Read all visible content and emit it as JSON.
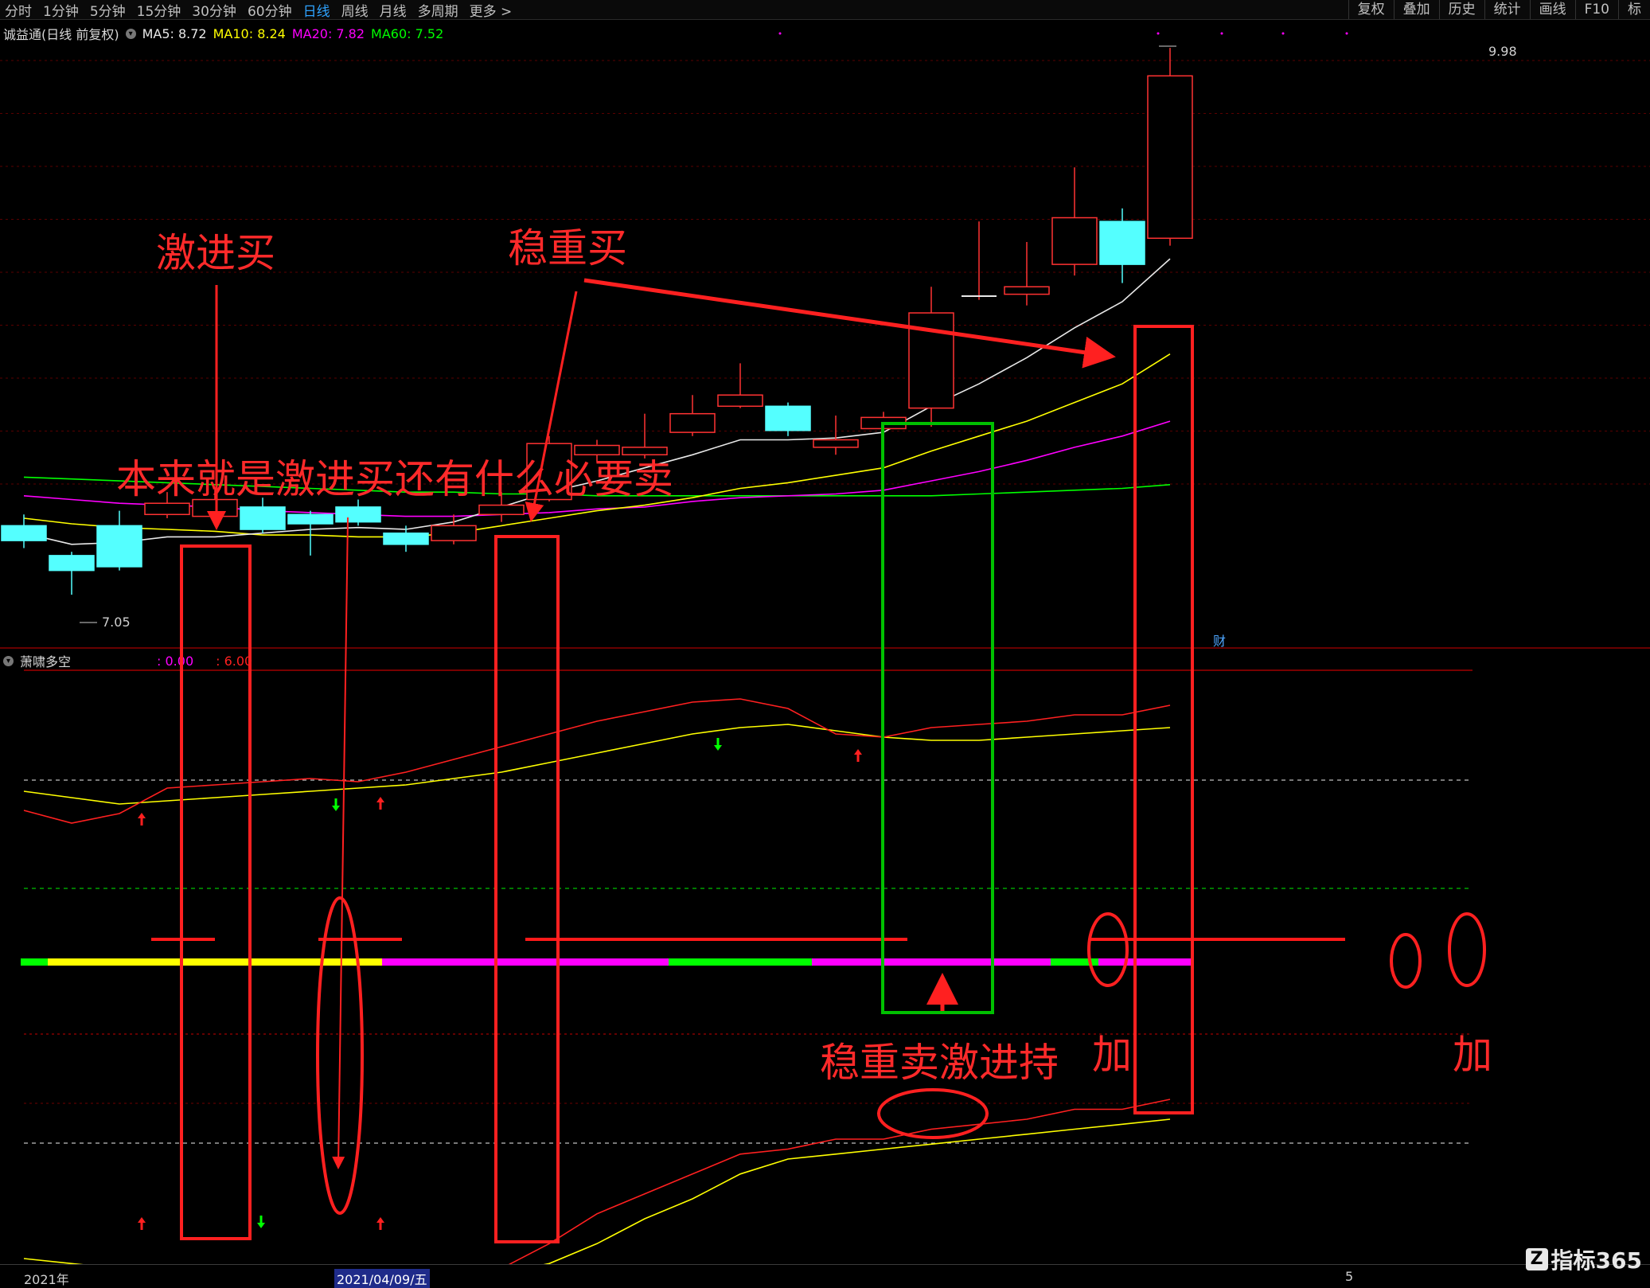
{
  "toolbar": {
    "period_tabs": [
      "分时",
      "1分钟",
      "5分钟",
      "15分钟",
      "30分钟",
      "60分钟",
      "日线",
      "周线",
      "月线",
      "多周期",
      "更多 >"
    ],
    "active_tab": "日线",
    "right_tabs": [
      "复权",
      "叠加",
      "历史",
      "统计",
      "画线",
      "F10",
      "标"
    ]
  },
  "main_legend": {
    "title": "诚益通(日线 前复权)",
    "ma5": "MA5: 8.72",
    "ma10": "MA10: 8.24",
    "ma20": "MA20: 7.82",
    "ma60": "MA60: 7.52",
    "colors": {
      "ma5": "#e8e8e8",
      "ma10": "#ffff00",
      "ma20": "#ff00ff",
      "ma60": "#00ff00"
    }
  },
  "price_labels": {
    "high": "9.98",
    "low": "7.05",
    "cai_badge": "财"
  },
  "indicator_legend": {
    "title": "萧啸多空",
    "v1": ": 0.00",
    "v2": ": 6.00"
  },
  "annotations": {
    "aggressive_buy": "激进买",
    "steady_buy": "稳重买",
    "why_sell": "本来就是激进买还有什么必要卖",
    "steady_sell": "稳重卖激进持",
    "add1": "加",
    "add2": "加"
  },
  "dates": {
    "year": "2021年",
    "selected": "2021/04/09/五",
    "right_marker": "5"
  },
  "logo": {
    "mark": "Z",
    "text": "指标365"
  },
  "chart_data": {
    "type": "candlestick",
    "candles": [
      {
        "o": 7.42,
        "c": 7.34,
        "h": 7.48,
        "l": 7.3
      },
      {
        "o": 7.26,
        "c": 7.18,
        "h": 7.28,
        "l": 7.05
      },
      {
        "o": 7.42,
        "c": 7.2,
        "h": 7.5,
        "l": 7.18
      },
      {
        "o": 7.48,
        "c": 7.54,
        "h": 7.6,
        "l": 7.46
      },
      {
        "o": 7.47,
        "c": 7.56,
        "h": 7.62,
        "l": 7.44
      },
      {
        "o": 7.52,
        "c": 7.4,
        "h": 7.57,
        "l": 7.38
      },
      {
        "o": 7.48,
        "c": 7.43,
        "h": 7.5,
        "l": 7.26
      },
      {
        "o": 7.52,
        "c": 7.44,
        "h": 7.56,
        "l": 7.42
      },
      {
        "o": 7.38,
        "c": 7.32,
        "h": 7.42,
        "l": 7.28
      },
      {
        "o": 7.34,
        "c": 7.42,
        "h": 7.48,
        "l": 7.32
      },
      {
        "o": 7.48,
        "c": 7.53,
        "h": 7.6,
        "l": 7.44
      },
      {
        "o": 7.56,
        "c": 7.86,
        "h": 7.9,
        "l": 7.55
      },
      {
        "o": 7.8,
        "c": 7.85,
        "h": 7.88,
        "l": 7.76
      },
      {
        "o": 7.8,
        "c": 7.84,
        "h": 8.02,
        "l": 7.78
      },
      {
        "o": 7.92,
        "c": 8.02,
        "h": 8.12,
        "l": 7.9
      },
      {
        "o": 8.06,
        "c": 8.12,
        "h": 8.29,
        "l": 8.05
      },
      {
        "o": 8.06,
        "c": 7.93,
        "h": 8.08,
        "l": 7.9
      },
      {
        "o": 7.84,
        "c": 7.88,
        "h": 8.01,
        "l": 7.8
      },
      {
        "o": 7.94,
        "c": 8.0,
        "h": 8.03,
        "l": 7.74
      },
      {
        "o": 8.05,
        "c": 8.56,
        "h": 8.7,
        "l": 7.95
      },
      {
        "o": 8.65,
        "c": 8.65,
        "h": 9.05,
        "l": 8.63
      },
      {
        "o": 8.66,
        "c": 8.7,
        "h": 8.94,
        "l": 8.6
      },
      {
        "o": 8.82,
        "c": 9.07,
        "h": 9.34,
        "l": 8.76
      },
      {
        "o": 9.05,
        "c": 8.82,
        "h": 9.12,
        "l": 8.72
      },
      {
        "o": 8.96,
        "c": 9.83,
        "h": 9.98,
        "l": 8.92
      }
    ],
    "ma5": [
      7.38,
      7.32,
      7.33,
      7.36,
      7.36,
      7.38,
      7.4,
      7.41,
      7.4,
      7.44,
      7.52,
      7.6,
      7.66,
      7.73,
      7.8,
      7.88,
      7.88,
      7.89,
      7.92,
      8.06,
      8.18,
      8.32,
      8.48,
      8.62,
      8.85
    ],
    "ma10": [
      7.46,
      7.43,
      7.41,
      7.4,
      7.39,
      7.37,
      7.37,
      7.36,
      7.36,
      7.38,
      7.42,
      7.46,
      7.5,
      7.53,
      7.57,
      7.62,
      7.65,
      7.69,
      7.73,
      7.82,
      7.9,
      7.98,
      8.08,
      8.18,
      8.34
    ],
    "ma20": [
      7.58,
      7.56,
      7.54,
      7.53,
      7.52,
      7.5,
      7.49,
      7.48,
      7.47,
      7.47,
      7.48,
      7.49,
      7.51,
      7.52,
      7.55,
      7.57,
      7.58,
      7.59,
      7.61,
      7.66,
      7.71,
      7.77,
      7.84,
      7.9,
      7.98
    ],
    "ma60": [
      7.68,
      7.67,
      7.66,
      7.65,
      7.64,
      7.63,
      7.62,
      7.61,
      7.6,
      7.6,
      7.59,
      7.59,
      7.58,
      7.58,
      7.58,
      7.58,
      7.58,
      7.58,
      7.58,
      7.58,
      7.59,
      7.6,
      7.61,
      7.62,
      7.64
    ],
    "upper_red": [
      52,
      48,
      51,
      59,
      60,
      61,
      62,
      61,
      64,
      68,
      72,
      76,
      80,
      83,
      86,
      87,
      84,
      76,
      75,
      78,
      79,
      80,
      82,
      82,
      85
    ],
    "upper_yellow": [
      58,
      56,
      54,
      55,
      56,
      57,
      58,
      59,
      60,
      62,
      64,
      67,
      70,
      73,
      76,
      78,
      79,
      77,
      75,
      74,
      74,
      75,
      76,
      77,
      78
    ],
    "lower_red": [
      2,
      1,
      1,
      2,
      2,
      2,
      2,
      2,
      1,
      1,
      2,
      7,
      13,
      17,
      21,
      25,
      26,
      28,
      28,
      30,
      31,
      32,
      34,
      34,
      36
    ],
    "lower_yellow": [
      4,
      3,
      2,
      2,
      2,
      2,
      2,
      2,
      2,
      1,
      1,
      3,
      7,
      12,
      16,
      21,
      24,
      25,
      26,
      27,
      28,
      29,
      30,
      31,
      32
    ],
    "state_bar": [
      "g",
      "y",
      "y",
      "y",
      "y",
      "y",
      "y",
      "y",
      "m",
      "m",
      "m",
      "m",
      "m",
      "m",
      "g",
      "g",
      "g",
      "m",
      "m",
      "m",
      "m",
      "m",
      "g",
      "m",
      "m"
    ],
    "buy_arrows_upper": [
      3,
      8,
      18
    ],
    "sell_arrows_upper": [
      7,
      15
    ],
    "buy_arrows_lower": [
      3,
      8
    ],
    "sell_arrows_lower": [
      5
    ]
  }
}
